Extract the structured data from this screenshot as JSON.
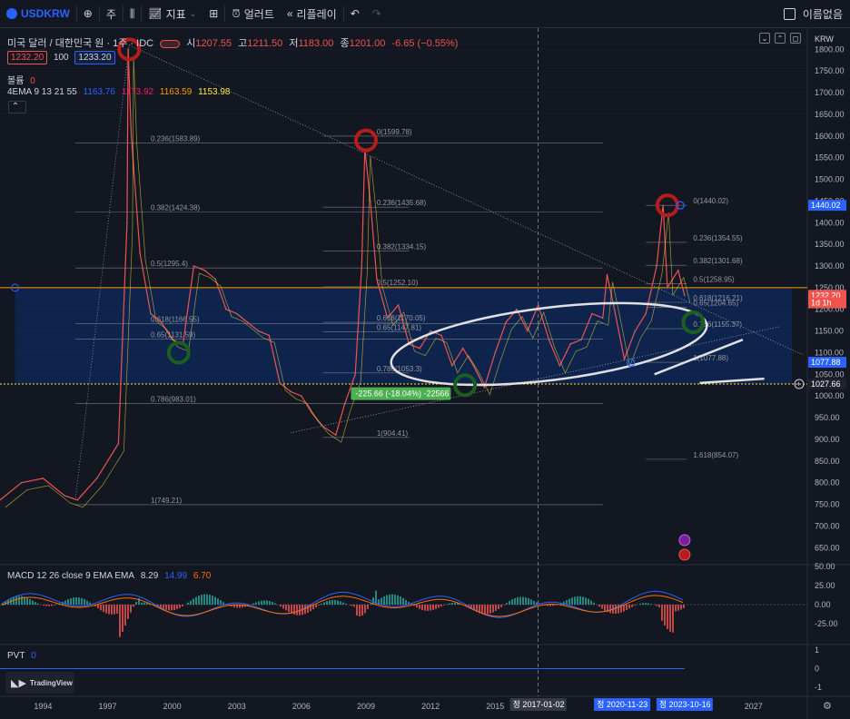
{
  "toolbar": {
    "symbol": "USDKRW",
    "interval": "주",
    "indicators": "지표",
    "alert": "얼러트",
    "replay": "리플레이",
    "unnamed": "이름없음"
  },
  "legend": {
    "title": "미국 달러 / 대한민국 원 · 1주 · IDC",
    "o_label": "시",
    "o": "1207.55",
    "h_label": "고",
    "h": "1211.50",
    "l_label": "저",
    "l": "1183.00",
    "c_label": "종",
    "c": "1201.00",
    "chg": "-6.65 (−0.55%)",
    "sell": "1232.20",
    "spread": "100",
    "buy": "1233.20",
    "vol_label": "볼륨",
    "vol": "0",
    "ema_label": "4EMA 9 13 21 55",
    "ema_vals": [
      "1163.76",
      "1173.92",
      "1163.59",
      "1153.98"
    ],
    "macd_label": "MACD 12 26 close 9 EMA EMA",
    "macd_vals": [
      "8.29",
      "14.99",
      "6.70"
    ],
    "pvt_label": "PVT",
    "pvt_val": "0"
  },
  "logo_text": "TradingView",
  "currency_label": "KRW",
  "colors": {
    "bg": "#131722",
    "grid": "#1e222d",
    "up": "#26a69a",
    "down": "#ef5350",
    "blue_box": "#0d2a5c",
    "ema9": "#2962ff",
    "ema13": "#e91e63",
    "ema21": "#ff9800",
    "ema55": "#ffeb3b",
    "macd": "#2962ff",
    "signal": "#ff6d00",
    "fib": "#787b86"
  },
  "chart_data": {
    "type": "line",
    "title": "미국 달러 / 대한민국 원 · 1주 · IDC",
    "x_ticks": [
      "1994",
      "1997",
      "2000",
      "2003",
      "2006",
      "2009",
      "2012",
      "2015",
      "2017-01-02",
      "2020-11-23",
      "2023-10-16",
      "2027"
    ],
    "y_ticks": [
      1800,
      1750,
      1700,
      1650,
      1600,
      1550,
      1500,
      1450,
      1400,
      1350,
      1300,
      1250,
      1200,
      1150,
      1100,
      1050,
      1000,
      950,
      900,
      850,
      800,
      750,
      700,
      650
    ],
    "ylim": [
      615,
      1830
    ],
    "xlim": [
      1992.0,
      2029.5
    ],
    "series": [
      {
        "name": "USDKRW",
        "x": [
          1992.0,
          1993.0,
          1994.0,
          1995.0,
          1995.6,
          1996.5,
          1997.5,
          1997.9,
          1997.95,
          1998.1,
          1998.5,
          1999.0,
          1999.5,
          2000.0,
          2000.5,
          2001.0,
          2001.5,
          2002.0,
          2002.5,
          2003.0,
          2003.5,
          2004.0,
          2004.5,
          2005.0,
          2005.5,
          2006.0,
          2006.5,
          2007.0,
          2007.6,
          2008.0,
          2008.5,
          2008.8,
          2008.95,
          2009.2,
          2009.5,
          2010.0,
          2010.5,
          2011.0,
          2011.5,
          2012.0,
          2012.5,
          2013.0,
          2013.5,
          2014.0,
          2014.5,
          2015.0,
          2015.5,
          2016.0,
          2016.5,
          2017.0,
          2017.5,
          2018.0,
          2018.5,
          2019.0,
          2019.5,
          2020.0,
          2020.2,
          2020.5,
          2021.0,
          2021.5,
          2022.0,
          2022.5,
          2022.8,
          2023.0,
          2023.5,
          2023.8
        ],
        "y": [
          760,
          800,
          810,
          770,
          760,
          810,
          890,
          1400,
          1800,
          1600,
          1330,
          1190,
          1170,
          1130,
          1120,
          1300,
          1290,
          1270,
          1200,
          1190,
          1170,
          1150,
          1140,
          1030,
          1010,
          1000,
          960,
          930,
          910,
          980,
          1050,
          1300,
          1570,
          1450,
          1270,
          1180,
          1210,
          1120,
          1110,
          1150,
          1140,
          1070,
          1110,
          1070,
          1020,
          1100,
          1170,
          1200,
          1150,
          1210,
          1130,
          1070,
          1120,
          1130,
          1190,
          1180,
          1280,
          1210,
          1085,
          1150,
          1190,
          1300,
          1440,
          1250,
          1290,
          1232
        ]
      },
      {
        "name": "MACD",
        "values": []
      },
      {
        "name": "PVT",
        "values": []
      }
    ],
    "fib_left": {
      "levels": [
        "0.236(1583.89)",
        "0.382(1424.38)",
        "0.5(1295.4)",
        "0.618(1166.55)",
        "0.65(1131.59)",
        "0.786(983.01)",
        "1(749.21)"
      ]
    },
    "fib_mid": {
      "levels": [
        "0(1599.78)",
        "0.236(1435.68)",
        "0.382(1334.15)",
        "0.5(1252.10)",
        "0.618(1170.05)",
        "0.65(1147.81)",
        "0.786(1053.3)",
        "1(904.41)"
      ]
    },
    "fib_right": {
      "levels": [
        "0(1440.02)",
        "0.236(1354.55)",
        "0.382(1301.68)",
        "0.5(1258.95)",
        "0.618(1216.21)",
        "0.65(1204.65)",
        "0.786(1155.37)",
        "1(1077.88)",
        "1.618(854.07)"
      ]
    },
    "box": {
      "top": 1250,
      "bottom": 1027.66
    },
    "measure_label": "-225.66 (-18.04%) -22566",
    "price_tags": [
      {
        "value": "1440.02",
        "price": 1440.02,
        "color": "#2962ff"
      },
      {
        "value": "1232.20",
        "price": 1232.2,
        "color": "#ef5350"
      },
      {
        "value": "1d 1h",
        "price": 1215,
        "color": "#ef5350"
      },
      {
        "value": "1077.88",
        "price": 1077.88,
        "color": "#2962ff"
      },
      {
        "value": "1027.66",
        "price": 1027.66,
        "color": "#ffffff"
      }
    ],
    "macd_axis": [
      "50.00",
      "25.00",
      "0.00",
      "-25.00"
    ],
    "pvt_axis": [
      "1",
      "0",
      "-1"
    ],
    "date_tags": [
      {
        "label": "2017-01-02",
        "icon": "정",
        "x": 2017.0,
        "color": "#363a45"
      },
      {
        "label": "2020-11-23",
        "icon": "정",
        "x": 2020.9,
        "color": "#2962ff"
      },
      {
        "label": "2023-10-16",
        "icon": "정",
        "x": 2023.8,
        "color": "#2962ff"
      }
    ]
  }
}
